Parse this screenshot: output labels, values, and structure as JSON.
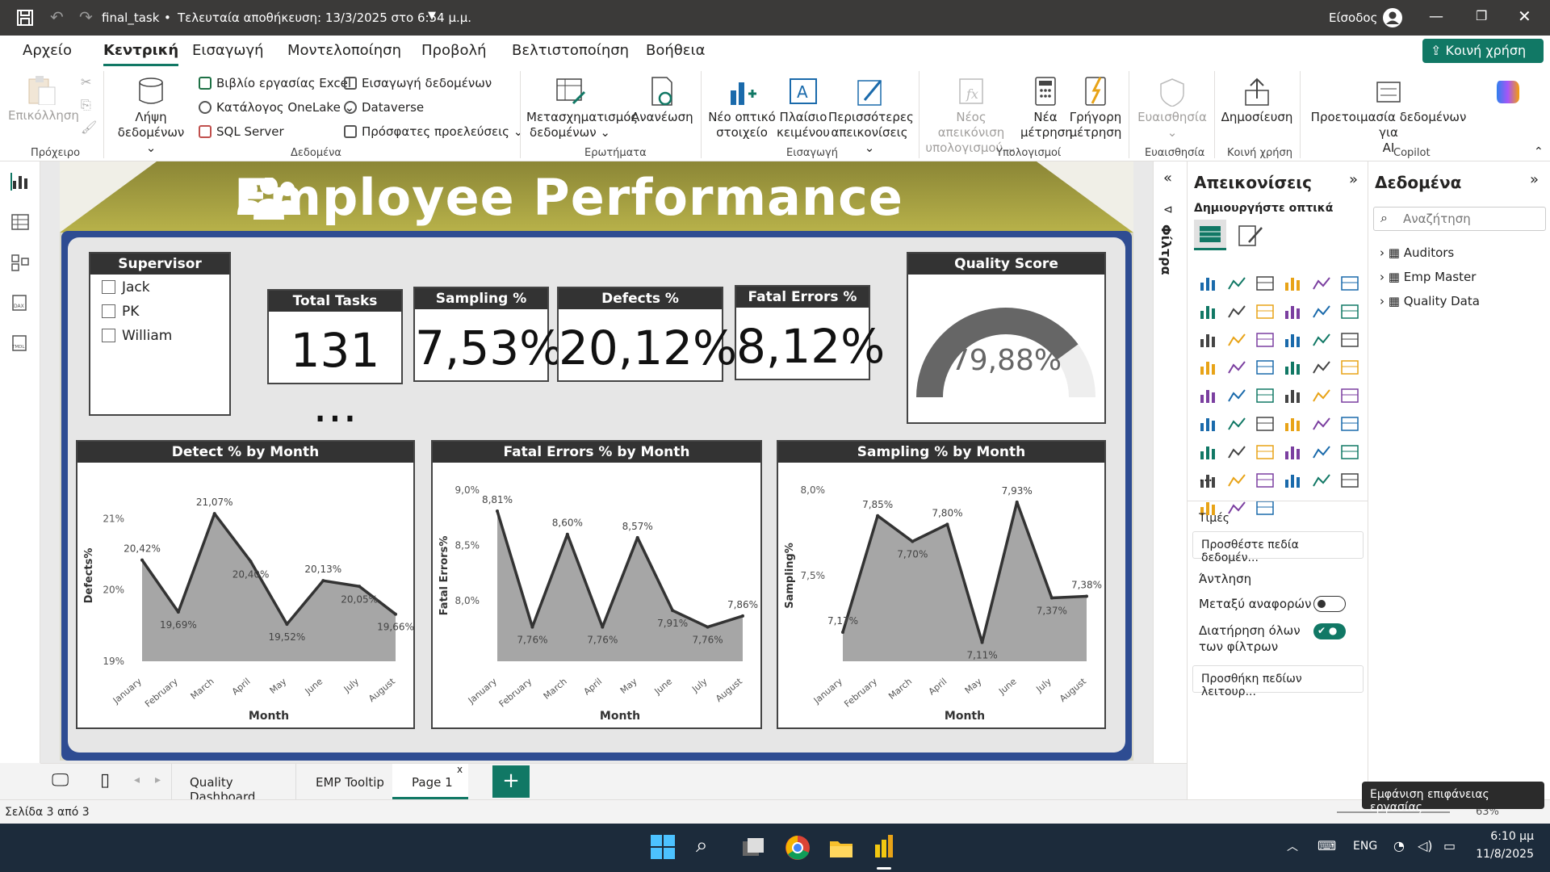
{
  "titlebar": {
    "file": "final_task",
    "saved": "Τελευταία αποθήκευση: 13/3/2025 στο 6:54 μ.μ.",
    "signin": "Είσοδος"
  },
  "menu": {
    "tabs": [
      "Αρχείο",
      "Κεντρική",
      "Εισαγωγή",
      "Μοντελοποίηση",
      "Προβολή",
      "Βελτιστοποίηση",
      "Βοήθεια"
    ],
    "share": "Κοινή χρήση"
  },
  "ribbon": {
    "paste": "Επικόλληση",
    "clipboard": "Πρόχειρο",
    "getdata": [
      "Λήψη",
      "δεδομένων"
    ],
    "excel": "Βιβλίο εργασίας Excel",
    "onelake": "Κατάλογος OneLake",
    "sql": "SQL Server",
    "enter": "Εισαγωγή δεδομένων",
    "dataverse": "Dataverse",
    "recent": "Πρόσφατες προελεύσεις",
    "data": "Δεδομένα",
    "transform": [
      "Μετασχηματισμός",
      "δεδομένων"
    ],
    "refresh": "Ανανέωση",
    "queries": "Ερωτήματα",
    "newvisual": [
      "Νέο οπτικό",
      "στοιχείο"
    ],
    "textbox": [
      "Πλαίσιο",
      "κειμένου"
    ],
    "morevisuals": [
      "Περισσότερες",
      "απεικονίσεις"
    ],
    "insert": "Εισαγωγή",
    "newcalc": [
      "Νέος απεικόνιση",
      "υπολογισμού"
    ],
    "newmeasure": [
      "Νέα",
      "μέτρηση"
    ],
    "quickmeasure": [
      "Γρήγορη",
      "μέτρηση"
    ],
    "calcs": "Υπολογισμοί",
    "sensitivity": "Ευαισθησία",
    "publish": "Δημοσίευση",
    "sharing": "Κοινή χρήση",
    "copilotprep": [
      "Προετοιμασία δεδομένων για",
      "AI"
    ],
    "copilot": "Copilot"
  },
  "report": {
    "title": "Employee Performance",
    "supervisor": {
      "header": "Supervisor",
      "items": [
        "Jack",
        "PK",
        "William"
      ]
    },
    "kpis": [
      {
        "label": "Total Tasks",
        "value": "131 ..."
      },
      {
        "label": "Sampling %",
        "value": "7,53%"
      },
      {
        "label": "Defects %",
        "value": "20,12%"
      },
      {
        "label": "Fatal Errors %",
        "value": "8,12%"
      }
    ],
    "gauge": {
      "label": "Quality Score",
      "value": "79,88%",
      "fraction": 0.7988
    }
  },
  "chart_data": [
    {
      "type": "area",
      "title": "Detect % by Month",
      "xlabel": "Month",
      "ylabel": "Defects%",
      "categories": [
        "January",
        "February",
        "March",
        "April",
        "May",
        "June",
        "July",
        "August"
      ],
      "values": [
        20.42,
        19.69,
        21.07,
        20.4,
        19.52,
        20.13,
        20.05,
        19.66
      ],
      "labels": [
        "20,42%",
        "19,69%",
        "21,07%",
        "20,40%",
        "19,52%",
        "20,13%",
        "20,05%",
        "19,66%"
      ],
      "yticks": [
        "19%",
        "20%",
        "21%"
      ],
      "ylim": [
        19,
        21.4
      ]
    },
    {
      "type": "area",
      "title": "Fatal Errors % by Month",
      "xlabel": "Month",
      "ylabel": "Fatal Errors%",
      "categories": [
        "January",
        "February",
        "March",
        "April",
        "May",
        "June",
        "July",
        "August"
      ],
      "values": [
        8.81,
        7.76,
        8.6,
        7.76,
        8.57,
        7.91,
        7.76,
        7.86
      ],
      "labels": [
        "8,81%",
        "7,76%",
        "8,60%",
        "7,76%",
        "8,57%",
        "7,91%",
        "7,76%",
        "7,86%"
      ],
      "yticks": [
        "8,0%",
        "8,5%",
        "9,0%"
      ],
      "ylim": [
        7.45,
        9.0
      ]
    },
    {
      "type": "area",
      "title": "Sampling % by Month",
      "xlabel": "Month",
      "ylabel": "Sampling%",
      "categories": [
        "January",
        "February",
        "March",
        "April",
        "May",
        "June",
        "July",
        "August"
      ],
      "values": [
        7.17,
        7.85,
        7.7,
        7.8,
        7.11,
        7.93,
        7.37,
        7.38
      ],
      "labels": [
        "7,17%",
        "7,85%",
        "7,70%",
        "7,80%",
        "7,11%",
        "7,93%",
        "7,37%",
        "7,38%"
      ],
      "yticks": [
        "7,5%",
        "8,0%"
      ],
      "ylim": [
        7.0,
        8.0
      ]
    }
  ],
  "vizpane": {
    "title": "Απεικονίσεις",
    "build": "Δημιουργήστε οπτικά",
    "values": "Τιμές",
    "values_ph": "Προσθέστε πεδία δεδομέν...",
    "drill": "Άντληση",
    "cross": "Μεταξύ αναφορών",
    "keep": [
      "Διατήρηση όλων",
      "των φίλτρων"
    ],
    "drill_ph": "Προσθήκη πεδίων λειτουρ...",
    "more": "..."
  },
  "filters": "Φίλτρα",
  "datapane": {
    "title": "Δεδομένα",
    "search": "Αναζήτηση",
    "tables": [
      "Auditors",
      "Emp Master",
      "Quality Data"
    ]
  },
  "pages": [
    "Quality Dashboard",
    "EMP Tooltip",
    "Page 1"
  ],
  "status": {
    "page": "Σελίδα 3 από 3",
    "zoom": "63%"
  },
  "tooltip": "Εμφάνιση επιφάνειας εργασίας",
  "taskbar": {
    "lang": "ENG",
    "time": "6:10 μμ",
    "date": "11/8/2025"
  }
}
